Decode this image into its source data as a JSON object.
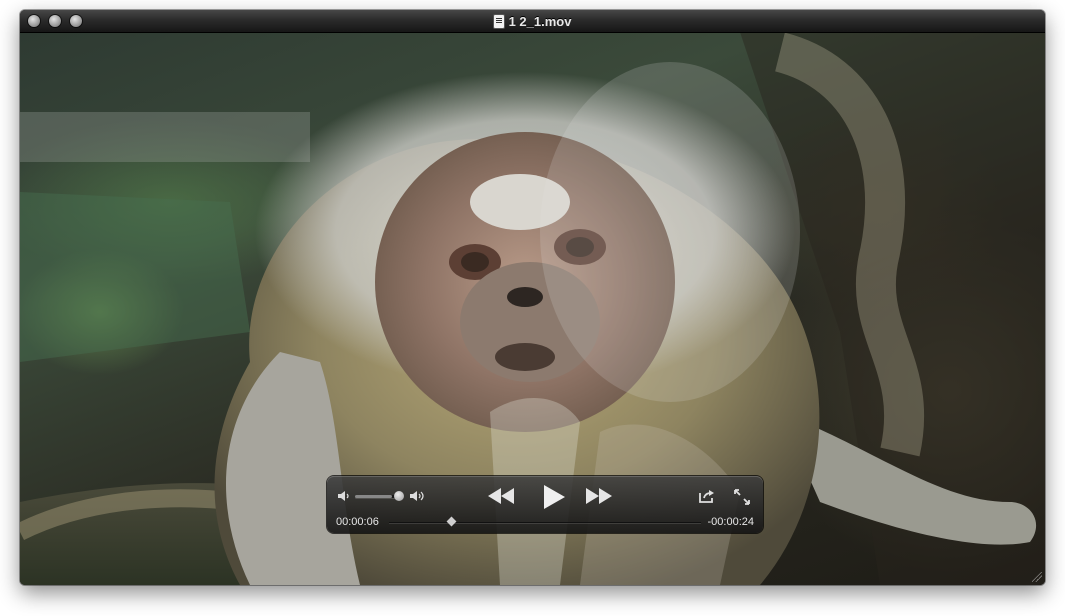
{
  "window": {
    "title": "1 2_1.mov",
    "file_icon": "movie-document-icon",
    "traffic_lights": [
      "close-icon",
      "minimize-icon",
      "zoom-icon"
    ]
  },
  "controller": {
    "elapsed": "00:00:06",
    "remaining": "-00:00:24",
    "volume_level": 0.85,
    "playback_position": 0.2,
    "playing": false,
    "icons": {
      "volume_low": "speaker-low-icon",
      "volume_high": "speaker-high-icon",
      "rewind": "rewind-icon",
      "play": "play-icon",
      "fast_forward": "fast-forward-icon",
      "share": "share-icon",
      "fullscreen": "fullscreen-icon"
    }
  },
  "colors": {
    "titlebar_top": "#474747",
    "titlebar_bottom": "#161616",
    "controller_bg": "#1f1f1f",
    "controller_text": "#e6e6e6"
  }
}
